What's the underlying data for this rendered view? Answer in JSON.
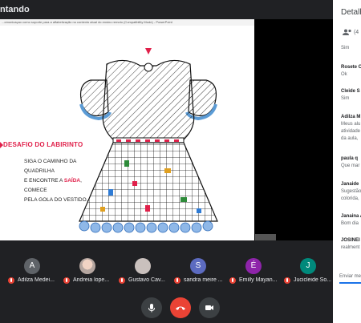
{
  "presenter_bar": {
    "title": "ntando"
  },
  "slide": {
    "window_title": "...omunicaçao como suporte para a alfabetização no contexto atual do ensino remoto (Compatibility Mode) - PowerPoint",
    "puzzle_title": "DESAFIO DO LABIRINTO",
    "instructions": [
      {
        "pre": "SIGA O CAMINHO DA QUADRILHA",
        "hl": "",
        "post": ""
      },
      {
        "pre": "E  ENCONTRE A ",
        "hl": "SAÍDA",
        "post": ", COMECE"
      },
      {
        "pre": "PELA GOLA DO VESTIDO.",
        "hl": "",
        "post": ""
      }
    ]
  },
  "participants": [
    {
      "initial": "A",
      "name": "Adilza Medei...",
      "color": "#5f6368"
    },
    {
      "initial": "",
      "name": "Andreia lope...",
      "color": "#b5a6a0"
    },
    {
      "initial": "",
      "name": "Gustavo Cav...",
      "color": "#c9c0bd"
    },
    {
      "initial": "S",
      "name": "sandra meire ...",
      "color": "#5c6bc0"
    },
    {
      "initial": "É",
      "name": "Émilly Mayan...",
      "color": "#8e24aa"
    },
    {
      "initial": "J",
      "name": "Jucicleide So...",
      "color": "#00897b"
    }
  ],
  "controls": {
    "mic_icon": "mic-icon",
    "end_icon": "phone-end-icon",
    "camera_icon": "camera-icon"
  },
  "panel": {
    "header": "Detalh",
    "people_count": "(4",
    "messages": [
      {
        "who": "",
        "text": "Sim"
      },
      {
        "who": "Rosete C",
        "text": "Ok"
      },
      {
        "who": "Cleide S",
        "text": "Sim"
      },
      {
        "who": "Adilza M",
        "text": "Meus alu"
      },
      {
        "who": "",
        "text": "atividade"
      },
      {
        "who": "",
        "text": "da aula,"
      },
      {
        "who": "paula q",
        "text": "Que mar"
      },
      {
        "who": "Janaide",
        "text": "Sugestão"
      },
      {
        "who": "",
        "text": "colorida,"
      },
      {
        "who": "Janaina A",
        "text": "Bom dia"
      },
      {
        "who": "JOSINEI",
        "text": "realment"
      }
    ],
    "input_placeholder": "Enviar me"
  }
}
